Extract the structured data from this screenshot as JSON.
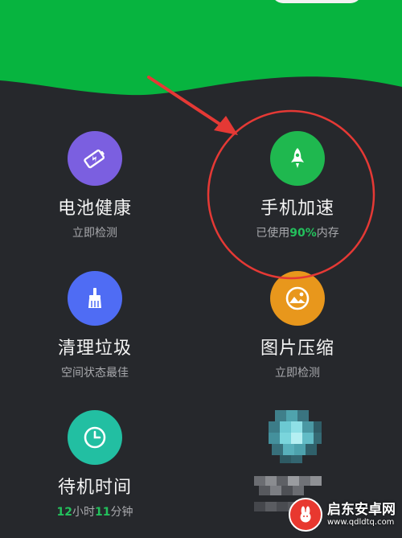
{
  "colors": {
    "header_green": "#07b43f",
    "background": "#26282c",
    "battery_icon": "#7b5fe0",
    "speed_icon": "#1fb84f",
    "clean_icon": "#4f6cf4",
    "photo_icon": "#e8971c",
    "standby_icon": "#22bfa2",
    "highlight": "#23c05c",
    "annotation_red": "#e53935"
  },
  "tiles": {
    "battery": {
      "icon": "battery-bolt-icon",
      "title": "电池健康",
      "subtitle": "立即检测"
    },
    "speed": {
      "icon": "rocket-icon",
      "title": "手机加速",
      "sub_prefix": "已使用",
      "sub_value": "90%",
      "sub_suffix": "内存"
    },
    "clean": {
      "icon": "broom-icon",
      "title": "清理垃圾",
      "subtitle": "空间状态最佳"
    },
    "photo": {
      "icon": "image-icon",
      "title": "图片压缩",
      "subtitle": "立即检测"
    },
    "standby": {
      "icon": "clock-icon",
      "title": "待机时间",
      "hours": "12",
      "hours_unit": "小时",
      "minutes": "11",
      "minutes_unit": "分钟"
    }
  },
  "watermark": {
    "icon": "rabbit-logo-icon",
    "name": "启东安卓网",
    "url": "www.qdldtq.com"
  }
}
